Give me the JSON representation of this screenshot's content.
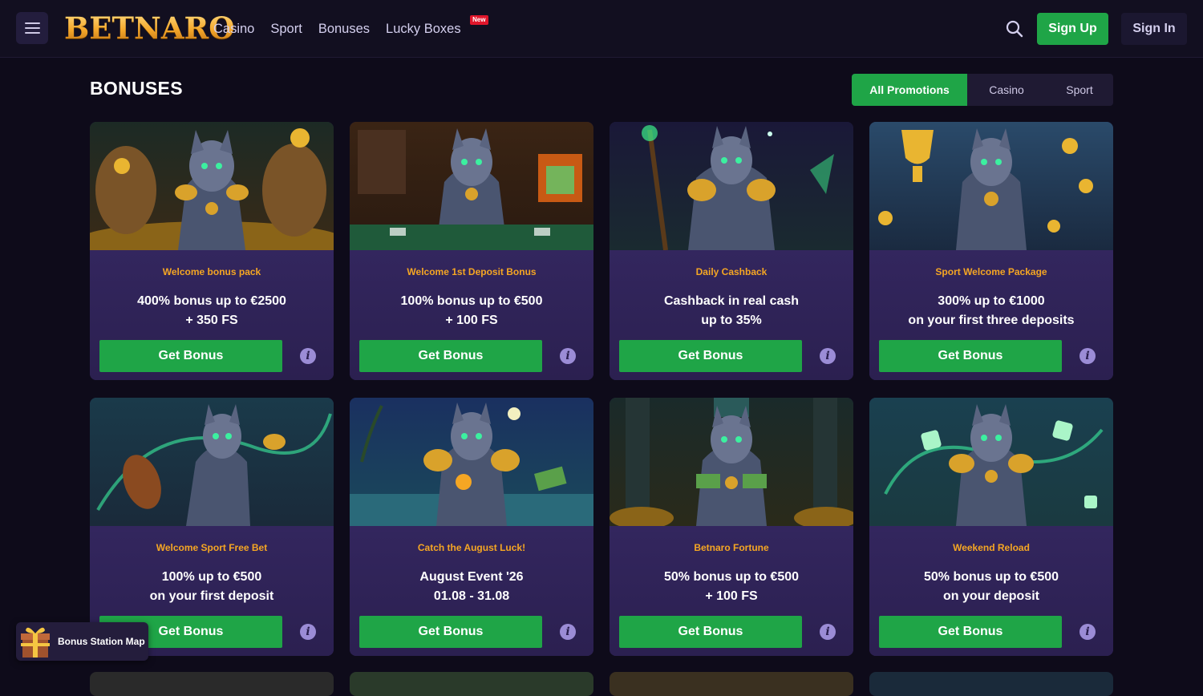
{
  "header": {
    "logo": "BETNARO",
    "nav": [
      {
        "label": "Casino"
      },
      {
        "label": "Sport"
      },
      {
        "label": "Bonuses"
      },
      {
        "label": "Lucky Boxes",
        "badge": "New"
      }
    ],
    "sign_up": "Sign Up",
    "sign_in": "Sign In"
  },
  "page_title": "BONUSES",
  "filters": {
    "tabs": [
      "All Promotions",
      "Casino",
      "Sport"
    ],
    "selected": "All Promotions"
  },
  "cards": [
    {
      "subtitle": "Welcome bonus pack",
      "line1": "400% bonus up to €2500",
      "line2": "+ 350 FS",
      "button": "Get Bonus",
      "scene": "gold-sacks"
    },
    {
      "subtitle": "Welcome 1st Deposit Bonus",
      "line1": "100% bonus up to €500",
      "line2": "+ 100 FS",
      "button": "Get Bonus",
      "scene": "tavern-table"
    },
    {
      "subtitle": "Daily Cashback",
      "line1": "Cashback in real cash",
      "line2": "up to 35%",
      "button": "Get Bonus",
      "scene": "staff-night"
    },
    {
      "subtitle": "Sport Welcome Package",
      "line1": "300% up to €1000",
      "line2": "on your first three deposits",
      "button": "Get Bonus",
      "scene": "trophy-coins"
    },
    {
      "subtitle": "Welcome Sport Free Bet",
      "line1": "100% up to €500",
      "line2": "on your first deposit",
      "button": "Get Bonus",
      "scene": "football-swirl"
    },
    {
      "subtitle": "Catch the August Luck!",
      "line1": "August Event '26",
      "line2": "01.08 - 31.08",
      "button": "Get Bonus",
      "scene": "beach-cash"
    },
    {
      "subtitle": "Betnaro Fortune",
      "line1": "50% bonus up to €500",
      "line2": "+ 100 FS",
      "button": "Get Bonus",
      "scene": "dungeon-cash"
    },
    {
      "subtitle": "Weekend Reload",
      "line1": "50% bonus up to €500",
      "line2": "on your deposit",
      "button": "Get Bonus",
      "scene": "dice-magic"
    }
  ],
  "bonus_station": "Bonus Station Map",
  "colors": {
    "accent_green": "#1fa547",
    "subtitle_orange": "#f5a623",
    "card_bg": "#2a1f4f",
    "page_bg": "#0e0b1a"
  },
  "icons": [
    "hamburger-icon",
    "search-icon",
    "info-icon",
    "gift-box-icon"
  ]
}
